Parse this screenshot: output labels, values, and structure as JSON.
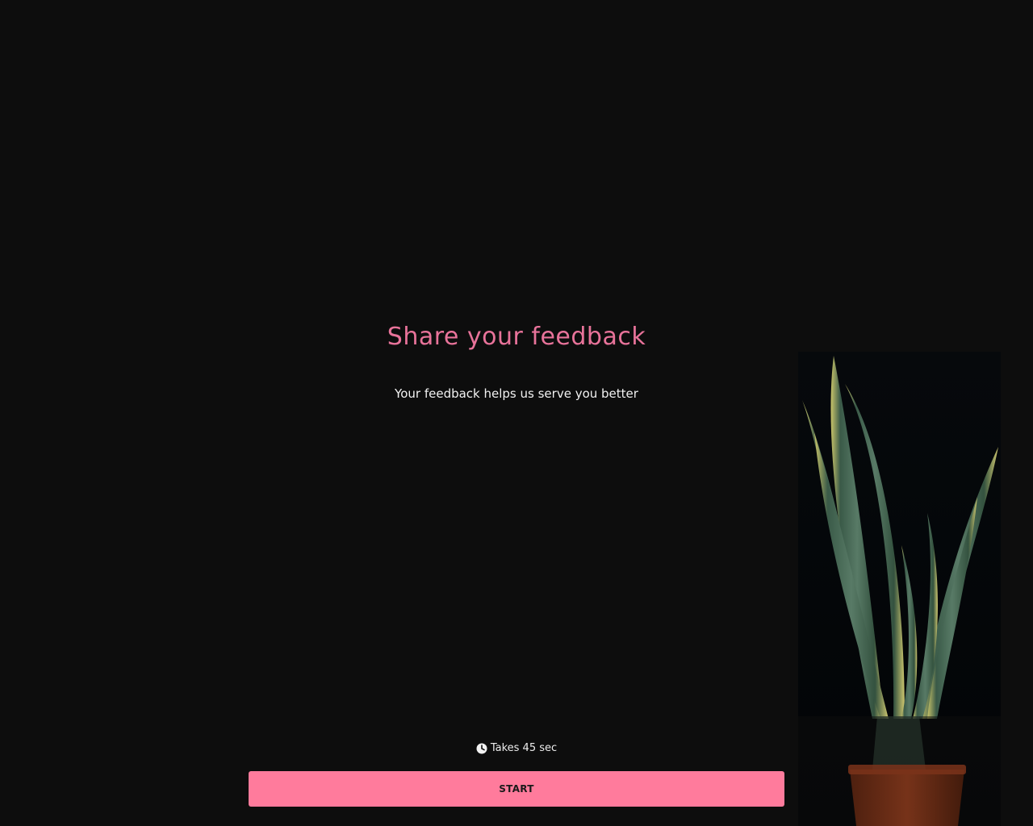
{
  "survey": {
    "title": "Share your feedback",
    "subtitle": "Your feedback helps us serve you better",
    "duration_text": "Takes 45 sec",
    "start_label": "START"
  },
  "icons": {
    "duration": "clock-icon"
  },
  "colors": {
    "background": "#0d0d0d",
    "accent": "#ff7b9c",
    "title": "#e8739a"
  }
}
